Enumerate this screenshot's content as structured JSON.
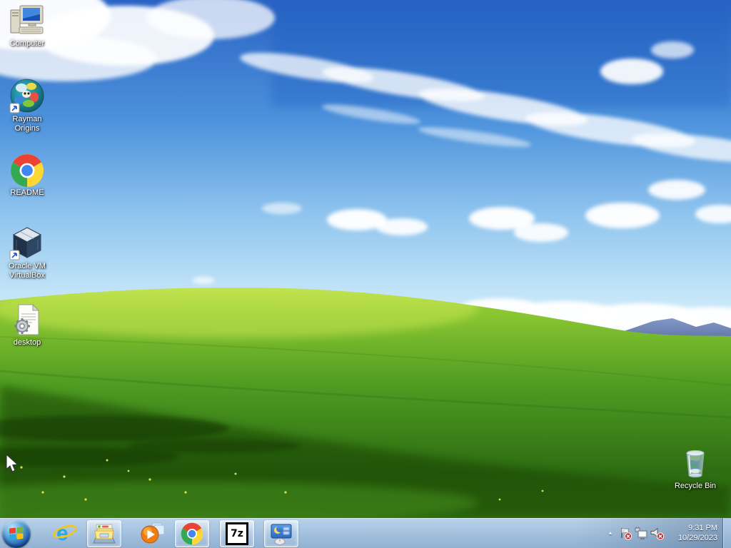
{
  "wallpaper": {
    "name": "bliss-green-hill-blue-sky",
    "colors": {
      "sky_top": "#2a63c4",
      "sky_horizon": "#e8f6fd",
      "grass_light": "#b2dc46",
      "grass_dark": "#1d4a0c",
      "mountain": "#5f77ab"
    }
  },
  "desktop": {
    "icons": [
      {
        "label": "Computer",
        "icon": "computer-icon"
      },
      {
        "label": "Rayman Origins",
        "icon": "rayman-origins-icon",
        "shortcut": true
      },
      {
        "label": "README",
        "icon": "chrome-file-icon"
      },
      {
        "label": "Oracle VM VirtualBox",
        "icon": "virtualbox-icon",
        "shortcut": true
      },
      {
        "label": "desktop",
        "icon": "config-file-gear-icon"
      },
      {
        "label": "Recycle Bin",
        "icon": "recycle-bin-icon"
      }
    ]
  },
  "taskbar": {
    "start_button": {
      "icon": "windows-start-orb"
    },
    "buttons": [
      {
        "name": "internet-explorer",
        "boxed": false
      },
      {
        "name": "windows-explorer",
        "boxed": true
      },
      {
        "name": "windows-media-player",
        "boxed": false
      },
      {
        "name": "google-chrome",
        "boxed": true
      },
      {
        "name": "7-zip",
        "boxed": true,
        "glyph": "7z"
      },
      {
        "name": "display-settings",
        "boxed": true
      }
    ],
    "tray": {
      "show_hidden_glyph": "▲",
      "icons": [
        "action-center-flag-error",
        "wired-network",
        "volume-muted"
      ],
      "clock": {
        "time": "9:31 PM",
        "date": "10/29/2023"
      }
    }
  }
}
